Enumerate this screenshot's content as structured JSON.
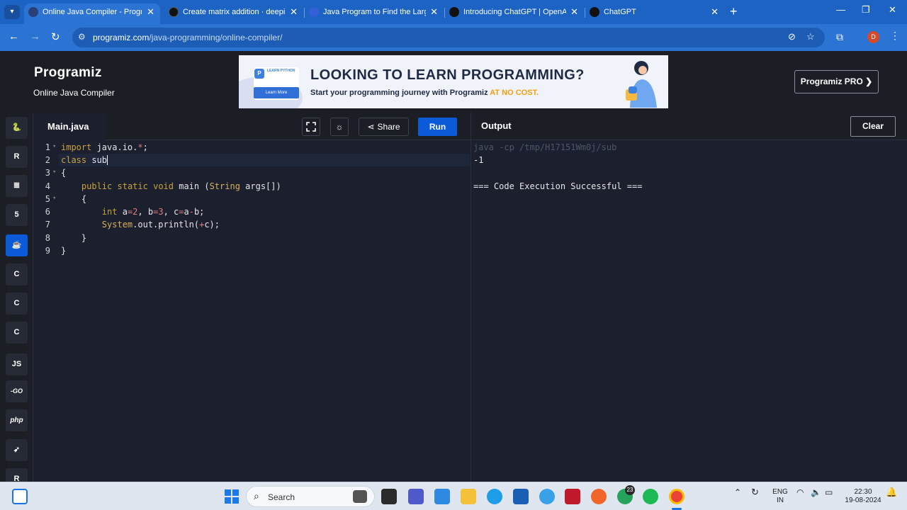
{
  "browser": {
    "tabs": [
      {
        "title": "Online Java Compiler - Program",
        "active": true
      },
      {
        "title": "Create matrix addition · deepik",
        "active": false
      },
      {
        "title": "Java Program to Find the Large",
        "active": false
      },
      {
        "title": "Introducing ChatGPT | OpenAI",
        "active": false
      },
      {
        "title": "ChatGPT",
        "active": false
      }
    ],
    "url_host": "programiz.com",
    "url_path": "/java-programming/online-compiler/",
    "profile_initial": "D"
  },
  "site": {
    "logo": "Programiz",
    "subtitle": "Online Java Compiler",
    "pro_button": "Programiz PRO ❯",
    "banner": {
      "chip_text": "LEARN PYTHON",
      "learn_more": "Learn More",
      "headline": "LOOKING TO LEARN PROGRAMMING?",
      "tagline": "Start your programming journey with Programiz ",
      "tagline_accent": "AT NO COST."
    }
  },
  "languages": [
    {
      "name": "python",
      "label": "🐍"
    },
    {
      "name": "r",
      "label": "R"
    },
    {
      "name": "sql",
      "label": "≣"
    },
    {
      "name": "html",
      "label": "5"
    },
    {
      "name": "java",
      "label": "☕",
      "active": true
    },
    {
      "name": "c",
      "label": "C"
    },
    {
      "name": "cpp",
      "label": "C"
    },
    {
      "name": "csharp",
      "label": "C"
    },
    {
      "name": "js",
      "label": "JS"
    },
    {
      "name": "go",
      "label": "-GO"
    },
    {
      "name": "php",
      "label": "php"
    },
    {
      "name": "swift",
      "label": "➶"
    },
    {
      "name": "rust",
      "label": "R"
    }
  ],
  "editor": {
    "file_tab": "Main.java",
    "share_label": "Share",
    "run_label": "Run",
    "line_numbers": [
      "1",
      "2",
      "3",
      "4",
      "5",
      "6",
      "7",
      "8",
      "9"
    ]
  },
  "output": {
    "title": "Output",
    "clear_label": "Clear",
    "lines": [
      "java -cp /tmp/H17151Wm0j/sub",
      "-1",
      "",
      "=== Code Execution Successful ==="
    ]
  },
  "taskbar": {
    "search_placeholder": "Search",
    "whatsapp_badge": "23",
    "lang_top": "ENG",
    "lang_bottom": "IN",
    "time": "22:30",
    "date": "19-08-2024"
  },
  "colors": {
    "browser_accent": "#2c74d4",
    "run_button": "#0b5bd9",
    "editor_bg": "#1b1f2e",
    "banner_accent": "#f59e0b"
  }
}
